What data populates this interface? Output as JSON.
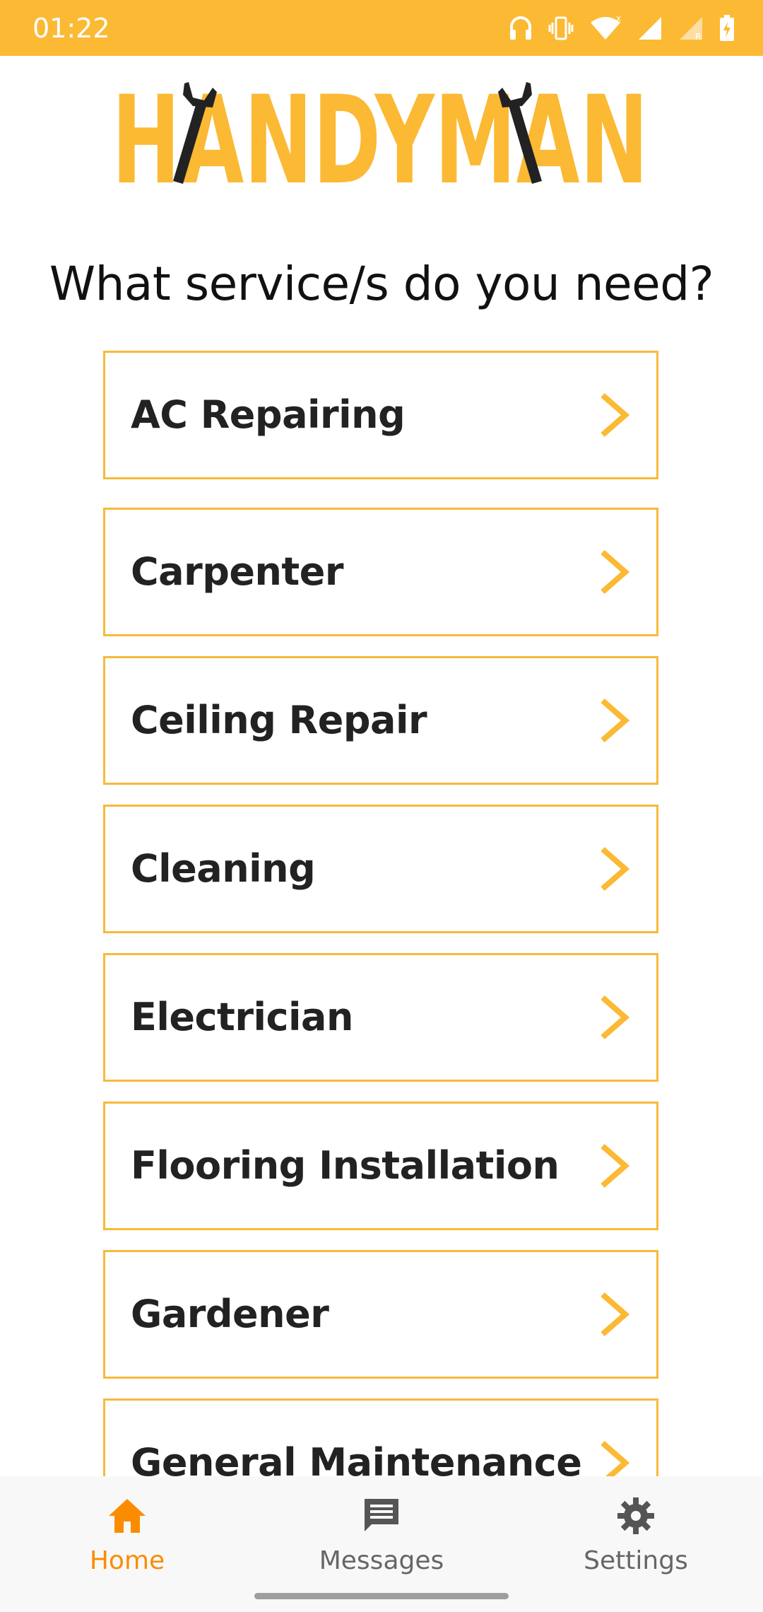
{
  "status_bar": {
    "time": "01:22",
    "icons": [
      "headset-icon",
      "vibrate-icon",
      "wifi-icon",
      "signal-icon",
      "signal-roaming-icon",
      "battery-charging-icon"
    ]
  },
  "brand": {
    "logo_text": "HANDYMAN",
    "primary_color": "#FBB934",
    "accent_color": "#FB8C00"
  },
  "main": {
    "question": "What service/s do you need?",
    "services": [
      {
        "label": "AC Repairing"
      },
      {
        "label": "Carpenter"
      },
      {
        "label": "Ceiling Repair"
      },
      {
        "label": "Cleaning"
      },
      {
        "label": "Electrician"
      },
      {
        "label": "Flooring Installation"
      },
      {
        "label": "Gardener"
      },
      {
        "label": "General Maintenance"
      }
    ]
  },
  "bottom_nav": {
    "items": [
      {
        "label": "Home",
        "icon": "home-icon",
        "active": true
      },
      {
        "label": "Messages",
        "icon": "message-icon",
        "active": false
      },
      {
        "label": "Settings",
        "icon": "gear-icon",
        "active": false
      }
    ]
  }
}
